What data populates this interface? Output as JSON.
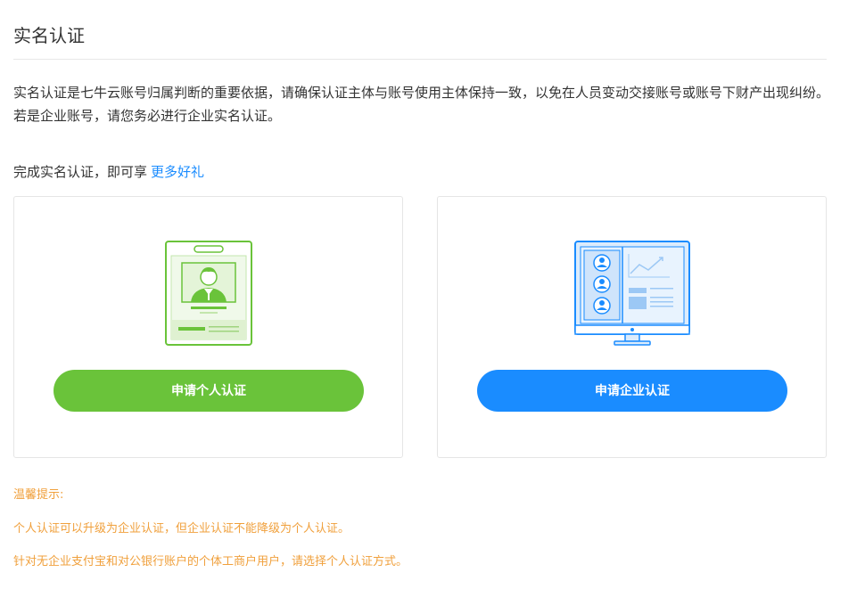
{
  "page": {
    "title": "实名认证",
    "description": "实名认证是七牛云账号归属判断的重要依据，请确保认证主体与账号使用主体保持一致，以免在人员变动交接账号或账号下财产出现纠纷。若是企业账号，请您务必进行企业实名认证。",
    "gift_text": "完成实名认证，即可享",
    "gift_link": "更多好礼"
  },
  "cards": {
    "personal": {
      "button_label": "申请个人认证",
      "icon": "id-card-icon",
      "color": "#6ac33a"
    },
    "enterprise": {
      "button_label": "申请企业认证",
      "icon": "enterprise-monitor-icon",
      "color": "#1a8cff"
    }
  },
  "tips": {
    "heading": "温馨提示:",
    "lines": [
      "个人认证可以升级为企业认证，但企业认证不能降级为个人认证。",
      "针对无企业支付宝和对公银行账户的个体工商户用户，请选择个人认证方式。"
    ],
    "color": "#f0a03c"
  }
}
